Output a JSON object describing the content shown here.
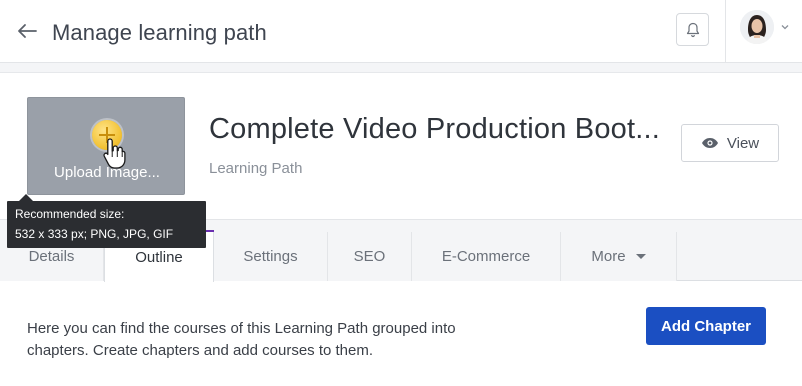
{
  "topbar": {
    "back_icon": "arrow-left-icon",
    "title": "Manage learning path",
    "bell_icon": "bell-icon",
    "avatar_icon": "user-avatar",
    "chevron_icon": "chevron-down-icon"
  },
  "header": {
    "upload_label": "Upload Image...",
    "upload_icon": "plus-circle-icon",
    "cursor_icon": "hand-pointer-icon",
    "course_title": "Complete Video Production Boot...",
    "course_type": "Learning Path",
    "view_label": "View",
    "view_icon": "eye-icon"
  },
  "tooltip": {
    "line1": "Recommended size:",
    "line2": "532 x 333 px; PNG, JPG, GIF"
  },
  "tabs": [
    {
      "label": "Details",
      "active": false
    },
    {
      "label": "Outline",
      "active": true
    },
    {
      "label": "Settings",
      "active": false
    },
    {
      "label": "SEO",
      "active": false
    },
    {
      "label": "E-Commerce",
      "active": false
    },
    {
      "label": "More",
      "active": false
    }
  ],
  "body": {
    "description": "Here you can find the courses of this Learning Path grouped into chapters. Create chapters and add courses to them.",
    "add_chapter_label": "Add Chapter"
  },
  "colors": {
    "accent": "#6a2fb0",
    "primary_button": "#1b4fc2",
    "upload_bg": "#9aa0a9"
  }
}
